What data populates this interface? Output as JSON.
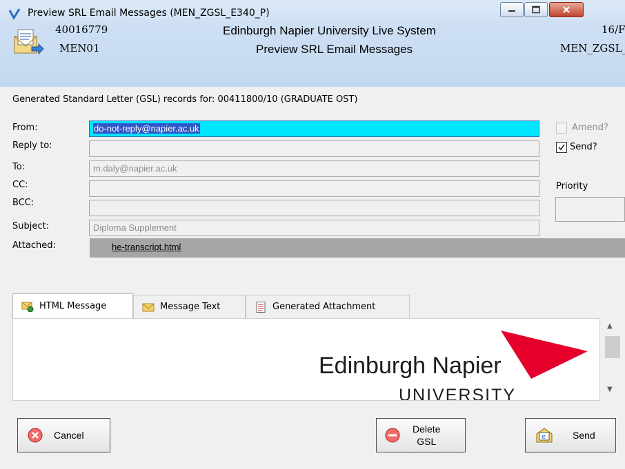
{
  "window": {
    "title": "Preview SRL Email Messages (MEN_ZGSL_E340_P)",
    "buttons": {
      "minimize": "minimize",
      "maximize": "maximize",
      "close": "close"
    }
  },
  "header": {
    "record_id": "40016779",
    "user": "MEN01",
    "system_name": "Edinburgh Napier University Live System",
    "screen_title": "Preview SRL Email Messages",
    "date_fragment": "16/F",
    "program_fragment": "MEN_ZGSL_"
  },
  "gsl_caption": "Generated Standard Letter (GSL) records for: 00411800/10 (GRADUATE   OST)",
  "form": {
    "from_label": "From:",
    "from_value": "do-not-reply@napier.ac.uk",
    "reply_to_label": "Reply to:",
    "reply_to_value": "",
    "to_label": "To:",
    "to_value": "m.daly@napier.ac.uk",
    "cc_label": "CC:",
    "cc_value": "",
    "bcc_label": "BCC:",
    "bcc_value": "",
    "subject_label": "Subject:",
    "subject_value": "Diploma Supplement",
    "attached_label": "Attached:",
    "attached_file": "he-transcript.html"
  },
  "options": {
    "amend_label": "Amend?",
    "amend_checked": false,
    "send_label": "Send?",
    "send_checked": true,
    "priority_label": "Priority",
    "priority_value": ""
  },
  "tabs": [
    {
      "label": "HTML Message",
      "icon": "envelope-globe-icon",
      "active": true
    },
    {
      "label": "Message Text",
      "icon": "envelope-icon",
      "active": false
    },
    {
      "label": "Generated Attachment",
      "icon": "document-icon",
      "active": false
    }
  ],
  "preview": {
    "logo_line1": "Edinburgh Napier",
    "logo_line2": "UNIVERSITY",
    "logo_color": "#e4002b"
  },
  "actions": {
    "cancel_label": "Cancel",
    "delete_label_line1": "Delete",
    "delete_label_line2": "GSL",
    "send_label": "Send"
  },
  "colors": {
    "active_field": "#00e6ff",
    "selection": "#2f56c8",
    "close_button": "#c0442c"
  }
}
